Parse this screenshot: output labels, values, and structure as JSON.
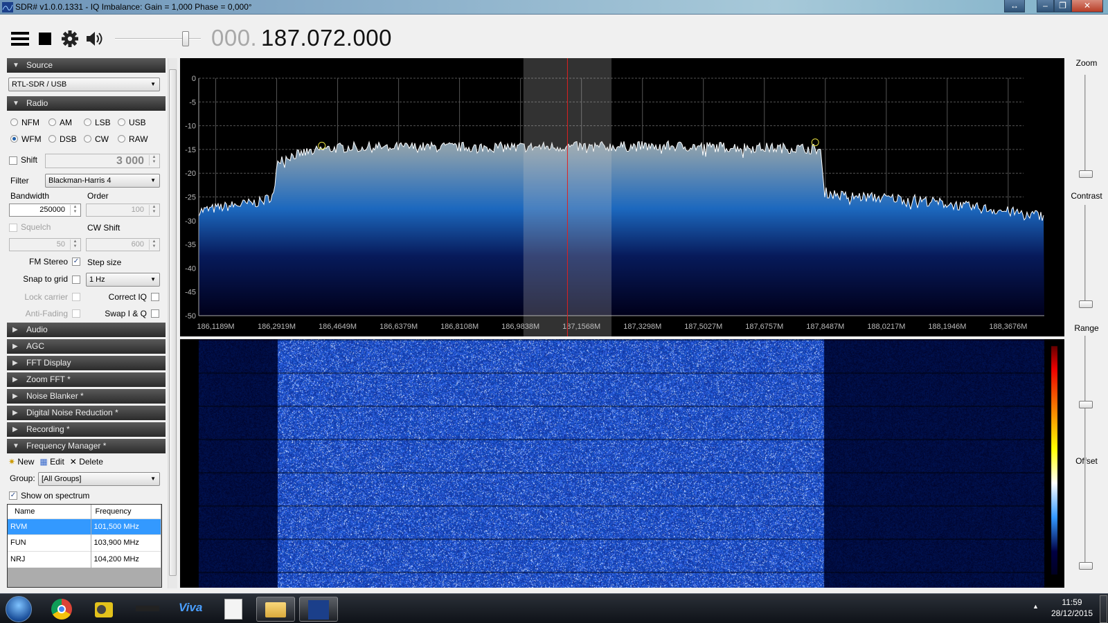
{
  "window": {
    "title": "SDR# v1.0.0.1331 - IQ Imbalance: Gain = 1,000 Phase = 0,000°",
    "buttons": {
      "resize": "↔",
      "minimize": "–",
      "restore": "❐",
      "close": "✕"
    }
  },
  "toolbar": {
    "icons": [
      "menu-icon",
      "stop-icon",
      "gear-icon",
      "speaker-icon"
    ],
    "volume": 0.85,
    "freq_prefix": "000.",
    "freq_main": "187.072.000"
  },
  "source": {
    "header": "Source",
    "device": "RTL-SDR / USB"
  },
  "radio": {
    "header": "Radio",
    "modes": [
      {
        "label": "NFM",
        "on": false
      },
      {
        "label": "AM",
        "on": false
      },
      {
        "label": "LSB",
        "on": false
      },
      {
        "label": "USB",
        "on": false
      },
      {
        "label": "WFM",
        "on": true
      },
      {
        "label": "DSB",
        "on": false
      },
      {
        "label": "CW",
        "on": false
      },
      {
        "label": "RAW",
        "on": false
      }
    ],
    "shift_label": "Shift",
    "shift_value": "3 000",
    "filter_label": "Filter",
    "filter_value": "Blackman-Harris 4",
    "bandwidth_label": "Bandwidth",
    "bandwidth_value": "250000",
    "order_label": "Order",
    "order_value": "100",
    "squelch_label": "Squelch",
    "cw_shift_label": "CW Shift",
    "squelch_value": "50",
    "cw_shift_value": "600",
    "fm_stereo_label": "FM Stereo",
    "step_size_label": "Step size",
    "snap_label": "Snap to grid",
    "step_value": "1 Hz",
    "lock_carrier_label": "Lock carrier",
    "correct_iq_label": "Correct IQ",
    "anti_fading_label": "Anti-Fading",
    "swap_iq_label": "Swap I & Q"
  },
  "panels": [
    "Audio",
    "AGC",
    "FFT Display",
    "Zoom FFT *",
    "Noise Blanker *",
    "Digital Noise Reduction *",
    "Recording *"
  ],
  "freq_manager": {
    "header": "Frequency Manager *",
    "new": "New",
    "edit": "Edit",
    "delete": "Delete",
    "group_label": "Group:",
    "group_value": "[All Groups]",
    "show_label": "Show on spectrum",
    "columns": [
      "Name",
      "Frequency"
    ],
    "rows": [
      [
        "RVM",
        "101,500 MHz"
      ],
      [
        "FUN",
        "103,900 MHz"
      ],
      [
        "NRJ",
        "104,200 MHz"
      ]
    ],
    "selected": 0
  },
  "right": {
    "zoom": "Zoom",
    "contrast": "Contrast",
    "range": "Range",
    "offset": "Offset",
    "zoom_level": 0.0,
    "contrast_level": 0.0,
    "range_level": 0.7,
    "offset_level": 0.0
  },
  "taskbar": {
    "time": "11:59",
    "date": "28/12/2015",
    "apps": [
      "start-orb",
      "chrome",
      "radio",
      "dab",
      "radio-viva",
      "document",
      "explorer",
      "sdrsharp"
    ]
  },
  "chart_data": {
    "type": "area",
    "xlim": [
      186.0708,
      188.47
    ],
    "ylim": [
      -50,
      0
    ],
    "y_ticks": [
      "0",
      "-5",
      "-10",
      "-15",
      "-20",
      "-25",
      "-30",
      "-35",
      "-40",
      "-45",
      "-50"
    ],
    "x_ticks": [
      "186,1189M",
      "186,2919M",
      "186,4649M",
      "186,6379M",
      "186,8108M",
      "186,9838M",
      "187,1568M",
      "187,3298M",
      "187,5027M",
      "187,6757M",
      "187,8487M",
      "188,0217M",
      "188,1946M",
      "188,3676M"
    ],
    "x_tick_values": [
      186.1189,
      186.2919,
      186.4649,
      186.6379,
      186.8108,
      186.9838,
      187.1568,
      187.3298,
      187.5027,
      187.6757,
      187.8487,
      188.0217,
      188.1946,
      188.3676
    ],
    "points": [
      [
        186.07,
        -28
      ],
      [
        186.15,
        -27
      ],
      [
        186.25,
        -26
      ],
      [
        186.285,
        -24.5
      ],
      [
        186.295,
        -17
      ],
      [
        186.35,
        -16
      ],
      [
        186.42,
        -15
      ],
      [
        186.5,
        -14.5
      ],
      [
        187.0,
        -14.5
      ],
      [
        187.4,
        -14.3
      ],
      [
        187.8,
        -14.8
      ],
      [
        187.835,
        -15
      ],
      [
        187.845,
        -24
      ],
      [
        187.9,
        -24.8
      ],
      [
        188.1,
        -25.5
      ],
      [
        188.25,
        -27
      ],
      [
        188.47,
        -29
      ]
    ],
    "peaks": [
      [
        186.42,
        -14.2
      ],
      [
        187.82,
        -13.5
      ]
    ],
    "tuned_mhz": 187.117,
    "filter_bandwidth_mhz": 0.25,
    "grid": true,
    "colors": {
      "line": "#ffffff",
      "cursor": "#e02020",
      "peak": "#e8e040"
    }
  }
}
